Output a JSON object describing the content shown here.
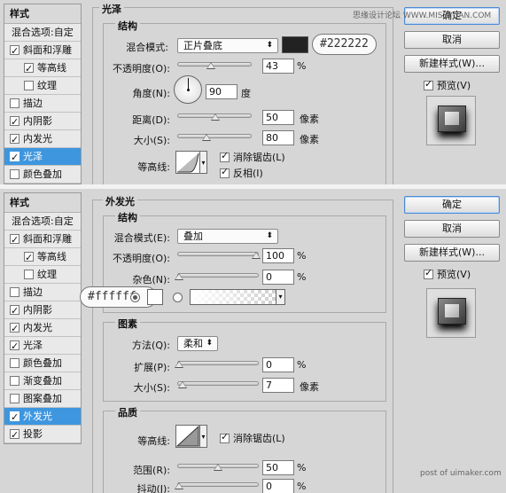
{
  "watermark_top": "思缘设计论坛 WWW.MISSYUAN.COM",
  "watermark_bottom": "post of uimaker.com",
  "panel1": {
    "style_list": {
      "header": "样式",
      "blend_options": "混合选项:自定",
      "items": [
        {
          "label": "斜面和浮雕",
          "checked": true
        },
        {
          "label": "等高线",
          "checked": true
        },
        {
          "label": "纹理",
          "checked": false
        },
        {
          "label": "描边",
          "checked": false
        },
        {
          "label": "内阴影",
          "checked": true
        },
        {
          "label": "内发光",
          "checked": true
        },
        {
          "label": "光泽",
          "checked": true,
          "selected": true
        },
        {
          "label": "颜色叠加",
          "checked": false
        }
      ]
    },
    "section_title": "光泽",
    "structure_title": "结构",
    "blend_mode_label": "混合模式:",
    "blend_mode_value": "正片叠底",
    "color_swatch": "#222222",
    "color_callout": "#222222",
    "opacity_label": "不透明度(O):",
    "opacity_value": "43",
    "opacity_unit": "%",
    "angle_label": "角度(N):",
    "angle_value": "90",
    "angle_unit": "度",
    "distance_label": "距离(D):",
    "distance_value": "50",
    "distance_unit": "像素",
    "size_label": "大小(S):",
    "size_value": "80",
    "size_unit": "像素",
    "contour_label": "等高线:",
    "antialias_label": "消除锯齿(L)",
    "antialias_checked": true,
    "invert_label": "反相(I)",
    "invert_checked": true,
    "buttons": {
      "ok": "确定",
      "cancel": "取消",
      "new_style": "新建样式(W)..."
    },
    "preview_label": "预览(V)",
    "preview_checked": true
  },
  "panel2": {
    "style_list": {
      "header": "样式",
      "blend_options": "混合选项:自定",
      "items": [
        {
          "label": "斜面和浮雕",
          "checked": true
        },
        {
          "label": "等高线",
          "checked": true
        },
        {
          "label": "纹理",
          "checked": false
        },
        {
          "label": "描边",
          "checked": false
        },
        {
          "label": "内阴影",
          "checked": true
        },
        {
          "label": "内发光",
          "checked": true
        },
        {
          "label": "光泽",
          "checked": true
        },
        {
          "label": "颜色叠加",
          "checked": false
        },
        {
          "label": "渐变叠加",
          "checked": false
        },
        {
          "label": "图案叠加",
          "checked": false
        },
        {
          "label": "外发光",
          "checked": true,
          "selected": true
        },
        {
          "label": "投影",
          "checked": true
        }
      ]
    },
    "section_title": "外发光",
    "structure_title": "结构",
    "blend_mode_label": "混合模式(E):",
    "blend_mode_value": "叠加",
    "opacity_label": "不透明度(O):",
    "opacity_value": "100",
    "opacity_unit": "%",
    "noise_label": "杂色(N):",
    "noise_value": "0",
    "noise_unit": "%",
    "color_callout": "#ffffff",
    "color_mode": "solid",
    "elements_title": "图素",
    "technique_label": "方法(Q):",
    "technique_value": "柔和",
    "spread_label": "扩展(P):",
    "spread_value": "0",
    "spread_unit": "%",
    "size_label": "大小(S):",
    "size_value": "7",
    "size_unit": "像素",
    "quality_title": "品质",
    "contour_label": "等高线:",
    "antialias_label": "消除锯齿(L)",
    "antialias_checked": true,
    "range_label": "范围(R):",
    "range_value": "50",
    "range_unit": "%",
    "jitter_label": "抖动(J):",
    "jitter_value": "0",
    "jitter_unit": "%",
    "buttons": {
      "ok": "确定",
      "cancel": "取消",
      "new_style": "新建样式(W)..."
    },
    "preview_label": "预览(V)",
    "preview_checked": true
  }
}
